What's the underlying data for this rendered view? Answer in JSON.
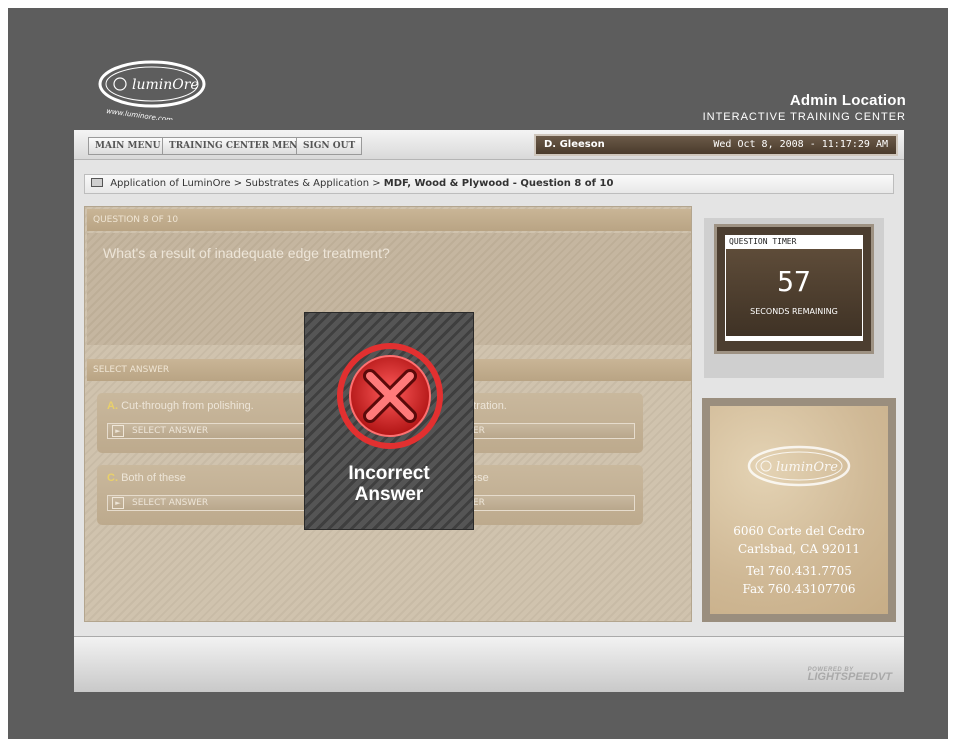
{
  "brand": {
    "logo_text": "luminOre",
    "logo_url_text": "www.luminore.com"
  },
  "location": {
    "title": "Admin Location",
    "subtitle": "INTERACTIVE TRAINING CENTER"
  },
  "nav": {
    "main_menu": "MAIN MENU",
    "training_center_menu": "TRAINING CENTER MENU",
    "sign_out": "SIGN OUT"
  },
  "user": {
    "name": "D. Gleeson",
    "datetime": "Wed Oct 8, 2008 - 11:17:29 AM"
  },
  "breadcrumb": {
    "part1": "Application of LuminOre",
    "part2": "Substrates & Application",
    "current": "MDF, Wood & Plywood - Question 8 of 10"
  },
  "question": {
    "header": "QUESTION 8 OF 10",
    "text": "What's a result of inadequate edge treatment?"
  },
  "answers": {
    "header": "SELECT ANSWER",
    "a": {
      "letter": "A.",
      "text": "Cut-through from polishing.",
      "button": "SELECT ANSWER"
    },
    "b": {
      "text": "netration.",
      "button": "WER"
    },
    "c": {
      "letter": "C.",
      "text": "Both of these",
      "button": "SELECT ANSWER"
    },
    "d": {
      "text": "ese",
      "button": "WER"
    }
  },
  "timer": {
    "label": "QUESTION TIMER",
    "seconds": "57",
    "caption": "SECONDS REMAINING"
  },
  "contact": {
    "street": "6060 Corte del Cedro",
    "city": "Carlsbad, CA 92011",
    "tel": "Tel 760.431.7705",
    "fax": "Fax 760.43107706"
  },
  "footer": {
    "powered_small": "POWERED BY",
    "powered": "LIGHTSPEEDVT"
  },
  "popup": {
    "line1": "Incorrect",
    "line2": "Answer"
  },
  "colors": {
    "accent_brown": "#4c3e30",
    "incorrect_red": "#e23030",
    "letter_yellow": "#e9d06a"
  }
}
